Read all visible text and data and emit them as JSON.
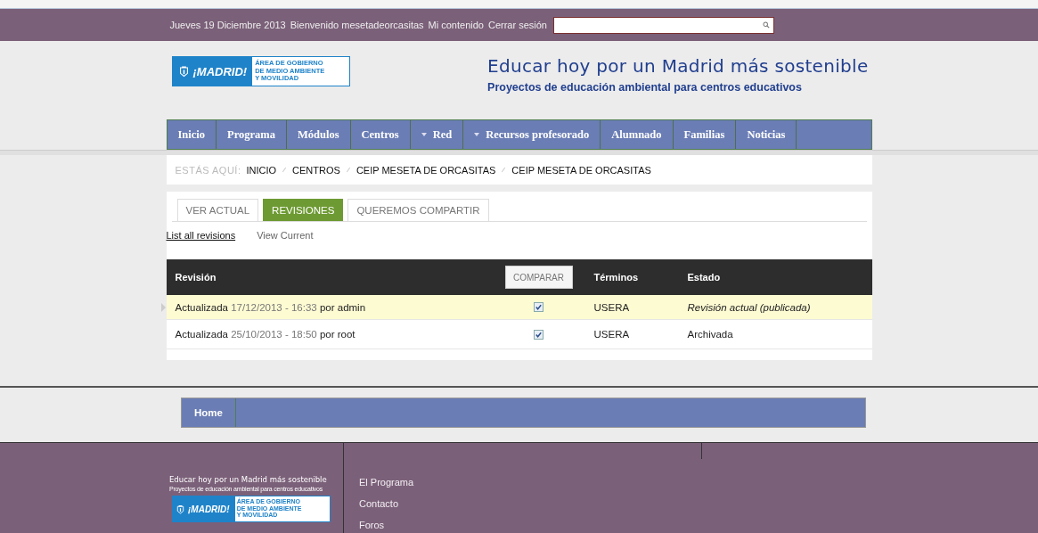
{
  "top_bar": {
    "date": "Jueves 19 Diciembre 2013",
    "welcome": "Bienvenido mesetadeorcasitas",
    "links": [
      "Mi contenido",
      "Cerrar sesión"
    ]
  },
  "header": {
    "logo": {
      "city": "¡MADRID!",
      "area": [
        "ÁREA DE GOBIERNO",
        "DE MEDIO AMBIENTE",
        "Y MOVILIDAD"
      ]
    },
    "title": "Educar hoy por un Madrid más sostenible",
    "subtitle": "Proyectos de educación ambiental para centros educativos"
  },
  "nav": [
    {
      "label": "Inicio",
      "dropdown": false
    },
    {
      "label": "Programa",
      "dropdown": false
    },
    {
      "label": "Módulos",
      "dropdown": false
    },
    {
      "label": "Centros",
      "dropdown": false
    },
    {
      "label": "Red",
      "dropdown": true
    },
    {
      "label": "Recursos profesorado",
      "dropdown": true
    },
    {
      "label": "Alumnado",
      "dropdown": false
    },
    {
      "label": "Familias",
      "dropdown": false
    },
    {
      "label": "Noticias",
      "dropdown": false
    }
  ],
  "breadcrumb": {
    "prefix": "ESTÁS AQUÍ:",
    "items": [
      "INICIO",
      "CENTROS",
      "CEIP MESETA DE ORCASITAS",
      "CEIP MESETA DE ORCASITAS"
    ]
  },
  "tabs": [
    {
      "label": "VER ACTUAL",
      "selected": false
    },
    {
      "label": "REVISIONES",
      "selected": true
    },
    {
      "label": "QUEREMOS COMPARTIR",
      "selected": false
    }
  ],
  "sub_links": [
    {
      "label": "List all revisions",
      "selected": true
    },
    {
      "label": "View Current",
      "selected": false
    }
  ],
  "table": {
    "columns": [
      {
        "label": "Revisión",
        "kind": "text"
      },
      {
        "label": "COMPARAR",
        "kind": "button"
      },
      {
        "label": "Términos",
        "kind": "text"
      },
      {
        "label": "Estado",
        "kind": "text"
      }
    ],
    "rows": [
      {
        "action": "Actualizada",
        "date": "17/12/2013 - 16:33",
        "author": "por admin",
        "checked": true,
        "terms": "USERA",
        "status": "Revisión actual (publicada)",
        "current": true
      },
      {
        "action": "Actualizada",
        "date": "25/10/2013 - 18:50",
        "author": "por root",
        "checked": true,
        "terms": "USERA",
        "status": "Archivada",
        "current": false
      }
    ]
  },
  "footer_menu": [
    {
      "label": "Home"
    }
  ],
  "footer": {
    "tagline": "Educar hoy por un Madrid más sostenible",
    "subline": "Proyectos de educación ambiental para centros educativos",
    "logo": {
      "city": "¡MADRID!",
      "area": [
        "ÁREA DE GOBIERNO",
        "DE MEDIO AMBIENTE",
        "Y MOVILIDAD"
      ]
    },
    "links": [
      "El Programa",
      "Contacto",
      "Foros"
    ]
  }
}
